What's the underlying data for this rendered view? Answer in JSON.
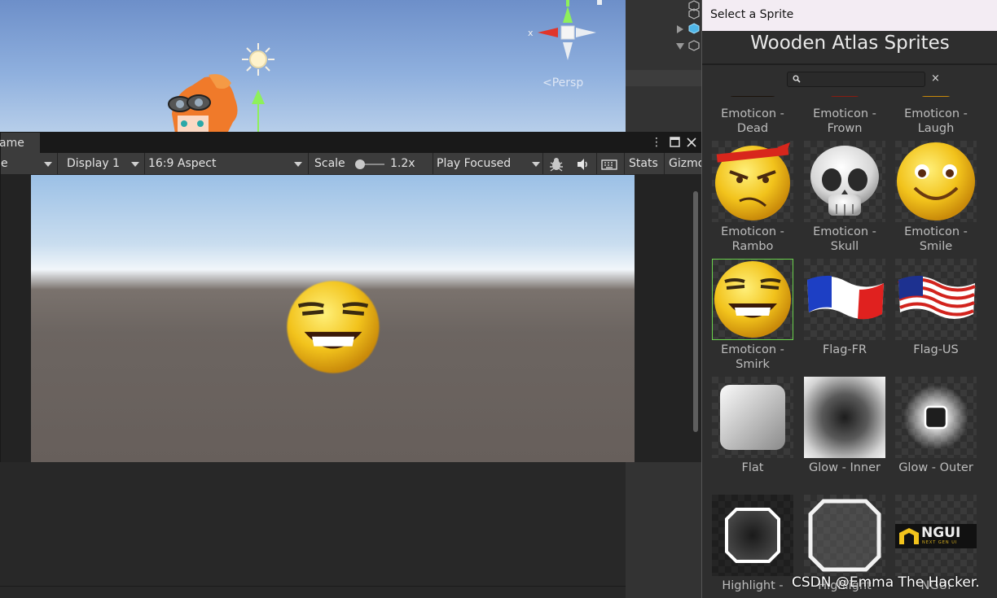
{
  "scene": {
    "persp_label": "Persp",
    "gizmo_axis_label": "x"
  },
  "game": {
    "tab_label": "ame",
    "toolbar": {
      "mode_value": "e",
      "display_value": "Display 1",
      "aspect_value": "16:9 Aspect",
      "scale_label": "Scale",
      "scale_value": "1.2x",
      "play_mode_value": "Play Focused",
      "stats_label": "Stats",
      "gizmos_label": "Gizmo"
    }
  },
  "selector": {
    "window_title": "Select a Sprite",
    "heading": "Wooden Atlas Sprites",
    "search_placeholder": "",
    "clear_label": "×",
    "sprites_row0": [
      {
        "label_l1": "Emoticon -",
        "label_l2": "Dead"
      },
      {
        "label_l1": "Emoticon -",
        "label_l2": "Frown"
      },
      {
        "label_l1": "Emoticon -",
        "label_l2": "Laugh"
      }
    ],
    "sprites": [
      {
        "label_l1": "Emoticon -",
        "label_l2": "Rambo",
        "icon": "rambo-emoji-icon"
      },
      {
        "label_l1": "Emoticon -",
        "label_l2": "Skull",
        "icon": "skull-icon"
      },
      {
        "label_l1": "Emoticon -",
        "label_l2": "Smile",
        "icon": "smile-emoji-icon"
      },
      {
        "label_l1": "Emoticon -",
        "label_l2": "Smirk",
        "icon": "smirk-emoji-icon",
        "selected": true
      },
      {
        "label_l1": "Flag-FR",
        "label_l2": "",
        "icon": "flag-fr-icon"
      },
      {
        "label_l1": "Flag-US",
        "label_l2": "",
        "icon": "flag-us-icon"
      },
      {
        "label_l1": "Flat",
        "label_l2": "",
        "icon": "flat-box-icon"
      },
      {
        "label_l1": "Glow - Inner",
        "label_l2": "",
        "icon": "glow-inner-icon"
      },
      {
        "label_l1": "Glow - Outer",
        "label_l2": "",
        "icon": "glow-outer-icon"
      },
      {
        "label_l1": "Highlight -",
        "label_l2": "",
        "icon": "highlight-icon"
      },
      {
        "label_l1": "Highlight",
        "label_l2": "",
        "icon": "highlight-thin-icon"
      },
      {
        "label_l1": "NGUI",
        "label_l2": "",
        "icon": "ngui-logo-icon",
        "logo_text": "NGUI",
        "logo_sub": "NEXT GEN UI"
      }
    ]
  },
  "watermark": "CSDN @Emma The Hacker.",
  "colors": {
    "selection_outline": "#6ad24c",
    "emoji_yellow": "#f2c31c"
  }
}
